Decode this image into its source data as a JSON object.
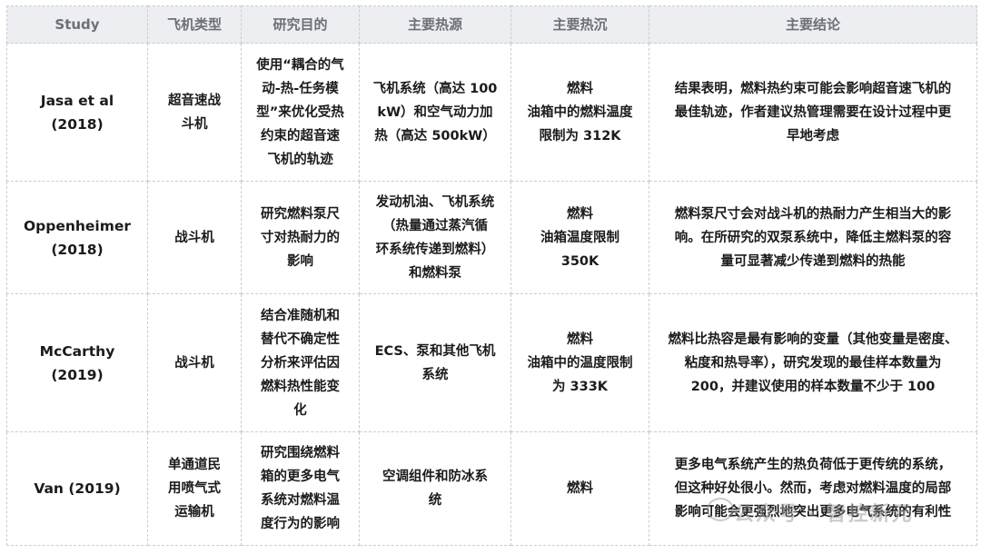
{
  "headers": [
    "Study",
    "飞机类型",
    "研究目的",
    "主要热源",
    "主要热沉",
    "主要结论"
  ],
  "rows": [
    {
      "study": [
        "Jasa et al (2018)"
      ],
      "aircraft": [
        "超音速战",
        "斗机"
      ],
      "purpose": [
        "使用“耦合的气",
        "动-热-任务模",
        "型”来优化受热",
        "约束的超音速",
        "飞机的轨迹"
      ],
      "heat_source": [
        "飞机系统（高达 100",
        "kW）和空气动力加",
        "热（高达 500kW）"
      ],
      "heat_sink": [
        "燃料",
        "油箱中的燃料温度",
        "限制为 312K"
      ],
      "conclusion": [
        "结果表明，燃料热约束可能会影响超音速飞机的",
        "最佳轨迹，作者建议热管理需要在设计过程中更",
        "早地考虑"
      ]
    },
    {
      "study": [
        "Oppenheimer",
        "(2018)"
      ],
      "aircraft": [
        "战斗机"
      ],
      "purpose": [
        "研究燃料泵尺",
        "寸对热耐力的",
        "影响"
      ],
      "heat_source": [
        "发动机油、飞机系统",
        "（热量通过蒸汽循",
        "环系统传递到燃料）",
        "和燃料泵"
      ],
      "heat_sink": [
        "燃料",
        "油箱温度限制",
        "350K"
      ],
      "conclusion": [
        "燃料泵尺寸会对战斗机的热耐力产生相当大的影",
        "响。在所研究的双泵系统中，降低主燃料泵的容",
        "量可显著减少传递到燃料的热能"
      ]
    },
    {
      "study": [
        "McCarthy",
        "(2019)"
      ],
      "aircraft": [
        "战斗机"
      ],
      "purpose": [
        "结合准随机和",
        "替代不确定性",
        "分析来评估因",
        "燃料热性能变",
        "化"
      ],
      "heat_source": [
        "ECS、泵和其他飞机",
        "系统"
      ],
      "heat_sink": [
        "燃料",
        "油箱中的温度限制",
        "为 333K"
      ],
      "conclusion": [
        "燃料比热容是最有影响的变量（其他变量是密度、",
        "粘度和热导率），研究发现的最佳样本数量为",
        "200，并建议使用的样本数量不少于 100"
      ]
    },
    {
      "study": [
        "Van (2019)"
      ],
      "aircraft": [
        "单通道民",
        "用喷气式",
        "运输机"
      ],
      "purpose": [
        "研究围绕燃料",
        "箱的更多电气",
        "系统对燃料温",
        "度行为的影响"
      ],
      "heat_source": [
        "空调组件和防冰系",
        "统"
      ],
      "heat_sink": [
        "燃料"
      ],
      "conclusion": [
        "更多电气系统产生的热负荷低于更传统的系统，",
        "但这种好处很小。然而，考虑对燃料温度的局部",
        "影响可能会更强烈地突出更多电气系统的有利性"
      ]
    }
  ],
  "watermark": "公众号 · 智控新元"
}
